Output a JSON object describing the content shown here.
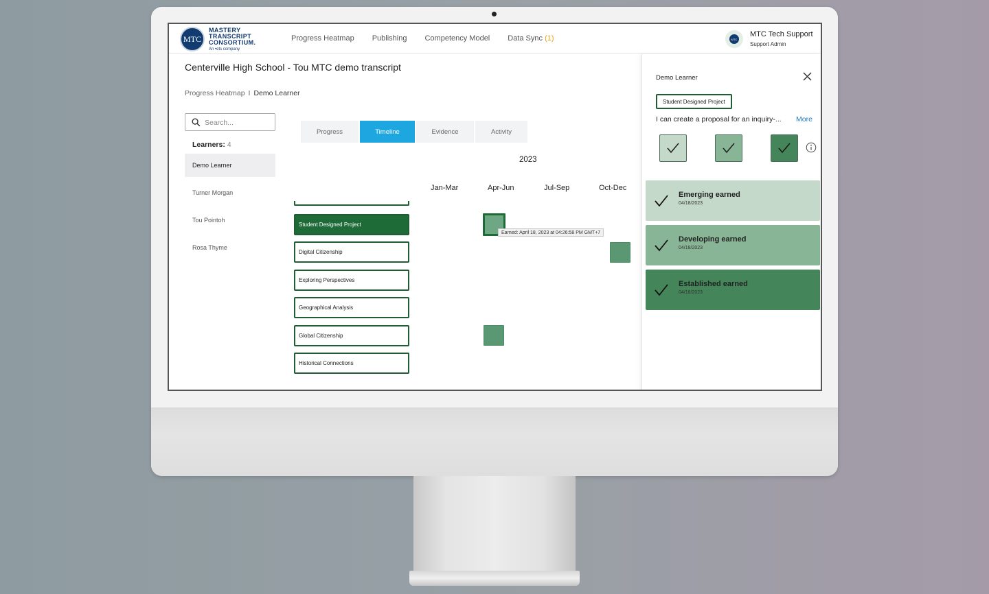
{
  "header": {
    "logo_mark": "MTC",
    "logo_lines": [
      "MASTERY",
      "TRANSCRIPT",
      "CONSORTIUM."
    ],
    "logo_sub": "An •ets company",
    "nav": [
      {
        "label": "Progress Heatmap"
      },
      {
        "label": "Publishing"
      },
      {
        "label": "Competency Model"
      },
      {
        "label": "Data Sync",
        "count": "(1)"
      }
    ],
    "user": {
      "avatar_text": "MTC",
      "name": "MTC Tech Support",
      "role": "Support Admin"
    }
  },
  "page": {
    "title": "Centerville High School - Tou MTC demo transcript",
    "breadcrumb": {
      "parent": "Progress Heatmap",
      "separator": "I",
      "current": "Demo Learner"
    }
  },
  "learners": {
    "search_placeholder": "Search...",
    "label": "Learners:",
    "count": "4",
    "items": [
      "Demo Learner",
      "Turner Morgan",
      "Tou Pointoh",
      "Rosa Thyme"
    ],
    "selected": "Demo Learner"
  },
  "tabs": [
    {
      "label": "Progress"
    },
    {
      "label": "Timeline",
      "active": true
    },
    {
      "label": "Evidence"
    },
    {
      "label": "Activity"
    }
  ],
  "timeline": {
    "year": "2023",
    "quarters": [
      "Jan-Mar",
      "Apr-Jun",
      "Jul-Sep",
      "Oct-Dec"
    ],
    "competencies": [
      {
        "label": "Student Designed Project",
        "selected": true,
        "earned_quarter": "Apr-Jun"
      },
      {
        "label": "Digital Citizenship",
        "earned_quarter": "Oct-Dec"
      },
      {
        "label": "Exploring Perspectives"
      },
      {
        "label": "Geographical Analysis"
      },
      {
        "label": "Global Citizenship",
        "earned_quarter": "Apr-Jun"
      },
      {
        "label": "Historical Connections"
      }
    ],
    "tooltip": "Earned: April 18, 2023 at 04:26:58 PM GMT+7"
  },
  "panel": {
    "learner": "Demo Learner",
    "chip": "Student Designed Project",
    "description": "I can create a proposal for an inquiry-...",
    "more_label": "More",
    "levels": [
      {
        "title": "Emerging earned",
        "date": "04/18/2023",
        "color": "#c5d9cb"
      },
      {
        "title": "Developing earned",
        "date": "04/18/2023",
        "color": "#88b596"
      },
      {
        "title": "Established earned",
        "date": "04/18/2023",
        "color": "#44865a"
      }
    ]
  },
  "colors": {
    "brand": "#123b70",
    "accent": "#1ea6e0",
    "competency_green": "#1e6b38",
    "badge_count": "#e8a317"
  }
}
